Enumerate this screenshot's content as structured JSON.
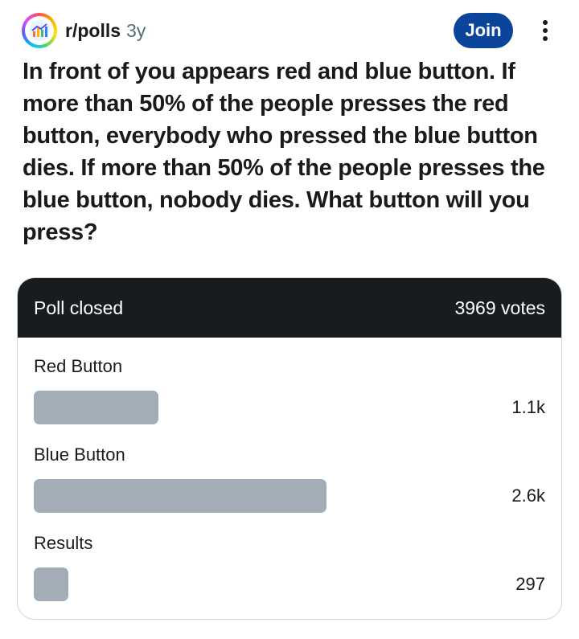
{
  "post": {
    "subreddit": "r/polls",
    "age": "3y",
    "join_label": "Join",
    "more_icon": "more-vertical-icon",
    "title": "In front of you appears red and blue button. If more than 50% of the people presses the red button, everybody who pressed the blue button dies. If more than 50% of the people presses the blue button, nobody dies. What button will you press?"
  },
  "poll": {
    "status": "Poll closed",
    "total_votes": "3969 votes",
    "options": [
      {
        "label": "Red Button",
        "count": "1.1k",
        "share": 0.29
      },
      {
        "label": "Blue Button",
        "count": "2.6k",
        "share": 0.68
      },
      {
        "label": "Results",
        "count": "297",
        "share": 0.08
      }
    ]
  },
  "colors": {
    "join_button": "#0a449b",
    "poll_header": "#181c1f",
    "bar_fill": "#a3adb7"
  }
}
